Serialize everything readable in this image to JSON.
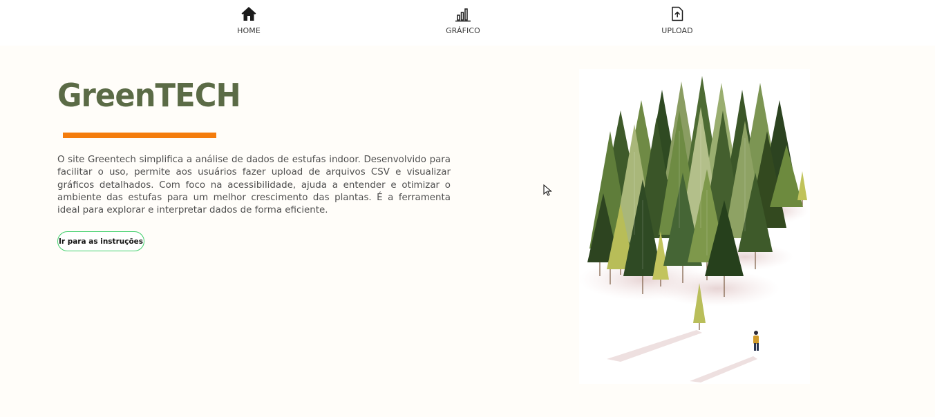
{
  "nav": {
    "items": [
      {
        "label": "HOME",
        "icon": "house-icon"
      },
      {
        "label": "GRÁFICO",
        "icon": "bar-chart-icon"
      },
      {
        "label": "UPLOAD",
        "icon": "file-upload-icon"
      }
    ]
  },
  "hero": {
    "title": "GreenTECH",
    "description": "O site Greentech simplifica a análise de dados de estufas indoor. Desenvolvido para facilitar o uso, permite aos usuários fazer upload de arquivos CSV e visualizar gráficos detalhados. Com foco na acessibilidade, ajuda a entender e otimizar o ambiente das estufas para um melhor crescimento das plantas. É a ferramenta ideal para explorar e interpretar dados de forma eficiente.",
    "button_label": "Ir para as instruções",
    "illustration": "forest-illustration"
  },
  "colors": {
    "title": "#5b6b46",
    "accent_bar": "#f47c0c",
    "button_border": "#3fcf6a",
    "background": "#fffdf9"
  }
}
